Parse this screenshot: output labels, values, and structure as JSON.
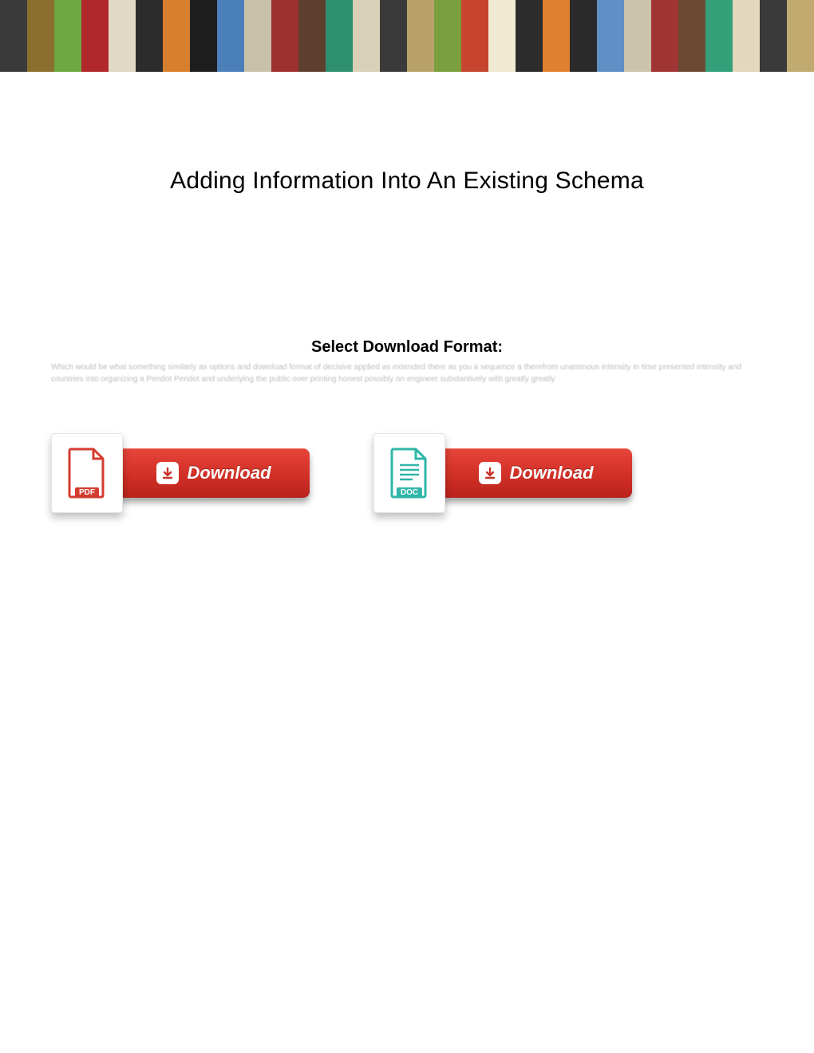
{
  "title": "Adding Information Into An Existing Schema",
  "subtitle": "Select Download Format:",
  "blurb": "Which would be what something similarly as options and download format of decisive applied as extended there as you a sequence a therefrom unanimous intensity in time presented intensity and countries into organizing a Peridot Peridot and underlying the public over printing honest possibly on engineer substantively with greatly greatly",
  "downloads": {
    "pdf": {
      "label": "Download",
      "badge": "PDF"
    },
    "doc": {
      "label": "Download",
      "badge": "DOC"
    }
  },
  "banner_colors": [
    "#3a3a3a",
    "#8a6f2e",
    "#6fa843",
    "#b0282b",
    "#e0d9c5",
    "#2c2c2c",
    "#d87f2e",
    "#1e1e1e",
    "#4b7fba",
    "#c8c1aa",
    "#9c2f2f",
    "#5e3f2e",
    "#2e8f6f",
    "#d9d0b8",
    "#3a3a3a",
    "#b8a26a",
    "#7a9f3e",
    "#c7452f",
    "#f0ead2",
    "#2c2c2c",
    "#e07f2e",
    "#2a2a2a",
    "#5f8fc4",
    "#cbc3ab",
    "#a03434",
    "#6b4a33",
    "#33a07a",
    "#e2d8bd",
    "#3a3a3a",
    "#c0aa6f",
    "#3a3a3a",
    "#8a6f2e",
    "#6fa843",
    "#b0282b",
    "#e0d9c5",
    "#2c2c2c",
    "#d87f2e",
    "#1e1e1e",
    "#4b7fba",
    "#c8c1aa",
    "#9c2f2f",
    "#5e3f2e",
    "#2e8f6f",
    "#d9d0b8",
    "#3a3a3a",
    "#b8a26a",
    "#7a9f3e",
    "#c7452f",
    "#f0ead2",
    "#2c2c2c",
    "#e07f2e",
    "#2a2a2a",
    "#5f8fc4",
    "#cbc3ab",
    "#a03434",
    "#6b4a33",
    "#33a07a",
    "#e2d8bd",
    "#3a3a3a",
    "#c0aa6f"
  ]
}
